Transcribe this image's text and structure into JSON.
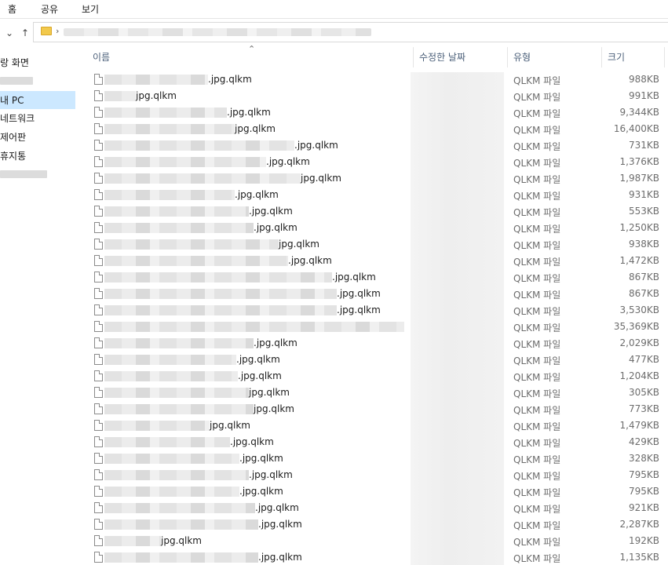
{
  "ribbon": {
    "tabs": [
      "홈",
      "공유",
      "보기"
    ]
  },
  "sidebar": {
    "items": [
      {
        "label": "랑 화면"
      },
      {
        "label": "내 PC"
      },
      {
        "label": "네트워크"
      },
      {
        "label": "제어판"
      },
      {
        "label": "휴지통"
      }
    ]
  },
  "columns": {
    "name": "이름",
    "date": "수정한 날짜",
    "type": "유형",
    "size": "크기"
  },
  "files": [
    {
      "name_suffix": ".jpg.qlkm",
      "type": "QLKM 파일",
      "size": "988KB"
    },
    {
      "name_suffix": "jpg.qlkm",
      "type": "QLKM 파일",
      "size": "991KB"
    },
    {
      "name_suffix": ".jpg.qlkm",
      "type": "QLKM 파일",
      "size": "9,344KB"
    },
    {
      "name_suffix": "jpg.qlkm",
      "type": "QLKM 파일",
      "size": "16,400KB"
    },
    {
      "name_suffix": ".jpg.qlkm",
      "type": "QLKM 파일",
      "size": "731KB"
    },
    {
      "name_suffix": ".jpg.qlkm",
      "type": "QLKM 파일",
      "size": "1,376KB"
    },
    {
      "name_suffix": "jpg.qlkm",
      "type": "QLKM 파일",
      "size": "1,987KB"
    },
    {
      "name_suffix": ".jpg.qlkm",
      "type": "QLKM 파일",
      "size": "931KB"
    },
    {
      "name_suffix": ".jpg.qlkm",
      "type": "QLKM 파일",
      "size": "553KB"
    },
    {
      "name_suffix": ".jpg.qlkm",
      "type": "QLKM 파일",
      "size": "1,250KB"
    },
    {
      "name_suffix": "jpg.qlkm",
      "type": "QLKM 파일",
      "size": "938KB"
    },
    {
      "name_suffix": ".jpg.qlkm",
      "type": "QLKM 파일",
      "size": "1,472KB"
    },
    {
      "name_suffix": ".jpg.qlkm",
      "type": "QLKM 파일",
      "size": "867KB"
    },
    {
      "name_suffix": ".jpg.qlkm",
      "type": "QLKM 파일",
      "size": "867KB"
    },
    {
      "name_suffix": ".jpg.qlkm",
      "type": "QLKM 파일",
      "size": "3,530KB"
    },
    {
      "name_suffix": "",
      "type": "QLKM 파일",
      "size": "35,369KB"
    },
    {
      "name_suffix": ".jpg.qlkm",
      "type": "QLKM 파일",
      "size": "2,029KB"
    },
    {
      "name_suffix": ".jpg.qlkm",
      "type": "QLKM 파일",
      "size": "477KB"
    },
    {
      "name_suffix": ".jpg.qlkm",
      "type": "QLKM 파일",
      "size": "1,204KB"
    },
    {
      "name_suffix": "jpg.qlkm",
      "type": "QLKM 파일",
      "size": "305KB"
    },
    {
      "name_suffix": "jpg.qlkm",
      "type": "QLKM 파일",
      "size": "773KB"
    },
    {
      "name_suffix": "jpg.qlkm",
      "type": "QLKM 파일",
      "size": "1,479KB"
    },
    {
      "name_suffix": ".jpg.qlkm",
      "type": "QLKM 파일",
      "size": "429KB"
    },
    {
      "name_suffix": ".jpg.qlkm",
      "type": "QLKM 파일",
      "size": "328KB"
    },
    {
      "name_suffix": ".jpg.qlkm",
      "type": "QLKM 파일",
      "size": "795KB"
    },
    {
      "name_suffix": ".jpg.qlkm",
      "type": "QLKM 파일",
      "size": "795KB"
    },
    {
      "name_suffix": ".jpg.qlkm",
      "type": "QLKM 파일",
      "size": "921KB"
    },
    {
      "name_suffix": ".jpg.qlkm",
      "type": "QLKM 파일",
      "size": "2,287KB"
    },
    {
      "name_suffix": "jpg.qlkm",
      "type": "QLKM 파일",
      "size": "192KB"
    },
    {
      "name_suffix": ".jpg.qlkm",
      "type": "QLKM 파일",
      "size": "1,135KB"
    }
  ]
}
